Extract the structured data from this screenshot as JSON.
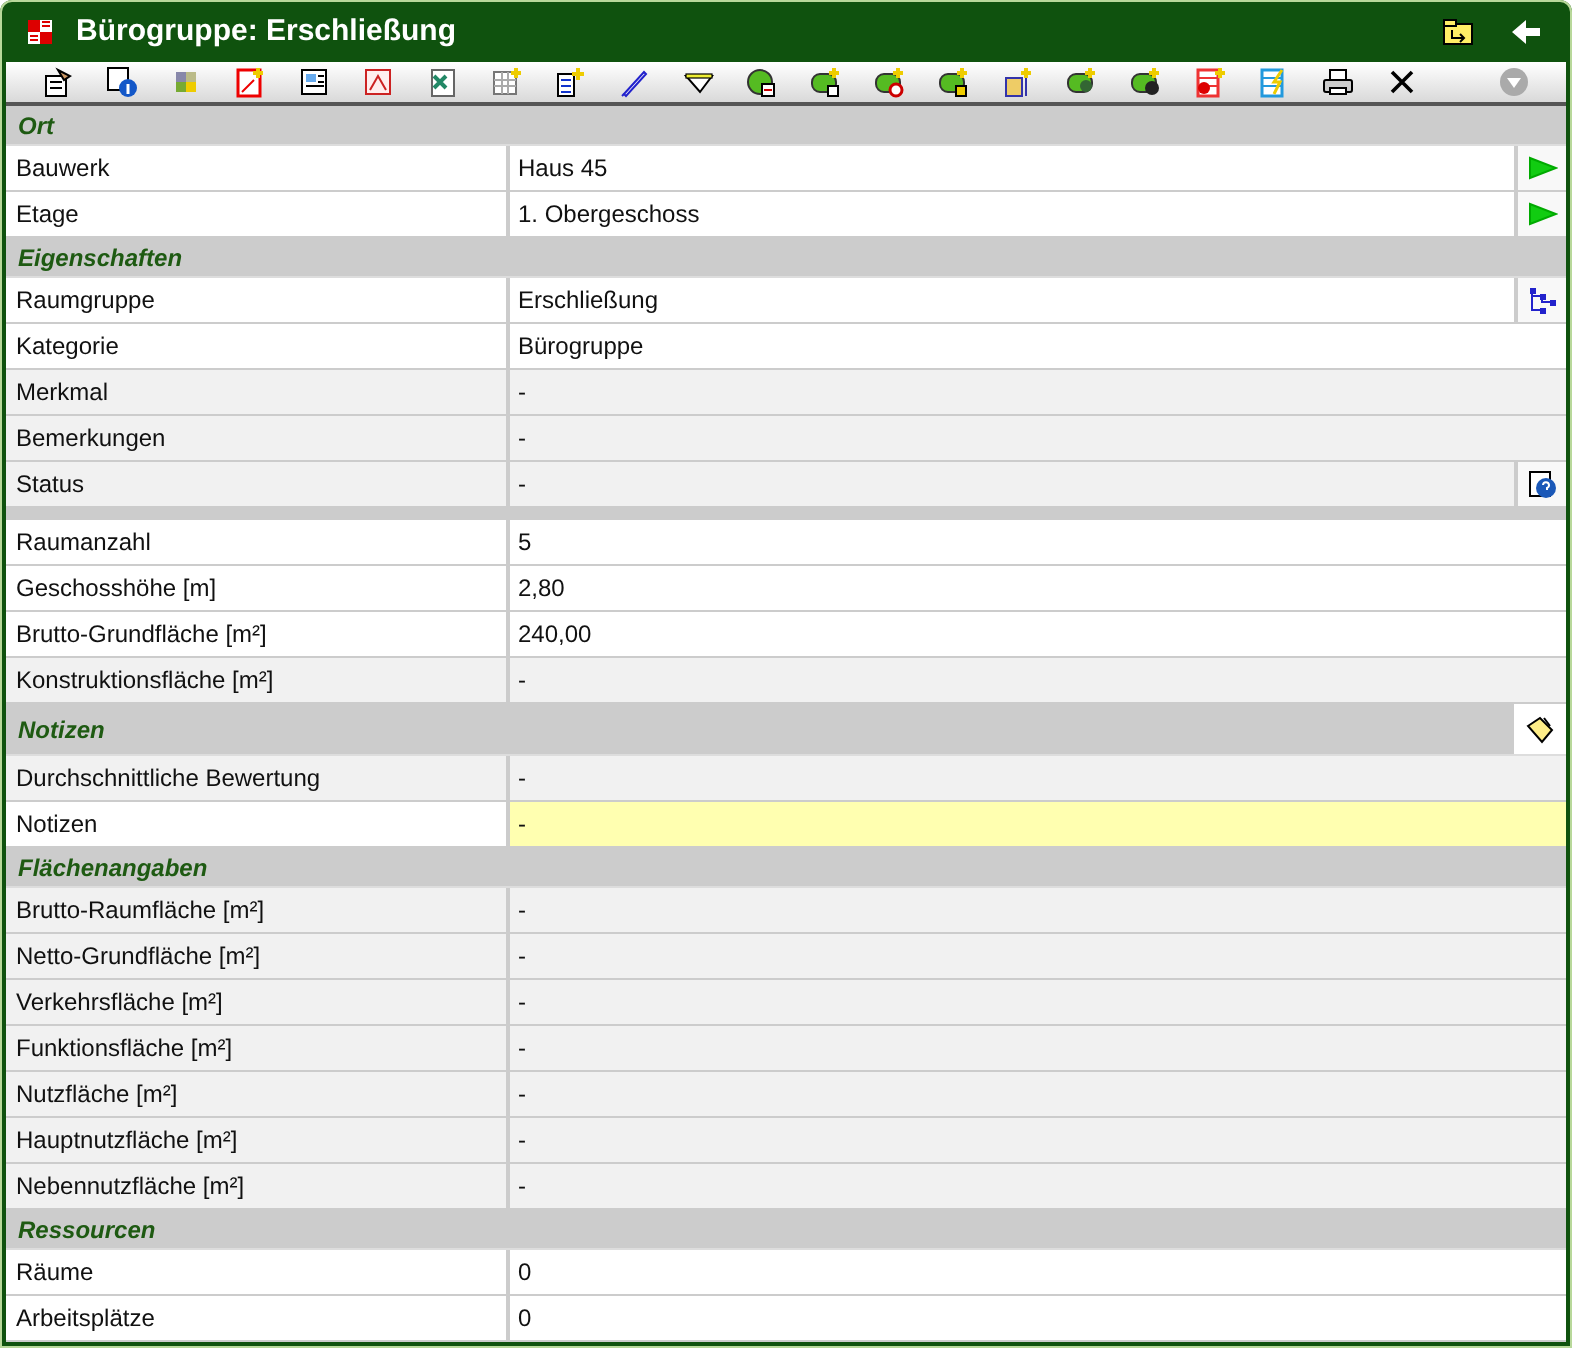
{
  "window": {
    "title": "Bürogruppe: Erschließung"
  },
  "sections": [
    {
      "kind": "titled",
      "title": "Ort",
      "rows": [
        {
          "kind": "link",
          "label": "Bauwerk",
          "value": "Haus 45",
          "dimmed": false,
          "highlighted": false
        },
        {
          "kind": "link",
          "label": "Etage",
          "value": "1. Obergeschoss",
          "dimmed": false,
          "highlighted": false
        }
      ]
    },
    {
      "kind": "titled",
      "title": "Eigenschaften",
      "rows": [
        {
          "kind": "tree",
          "label": "Raumgruppe",
          "value": "Erschließung",
          "dimmed": false,
          "highlighted": false
        },
        {
          "kind": "plain",
          "label": "Kategorie",
          "value": "Bürogruppe",
          "dimmed": false,
          "highlighted": false
        },
        {
          "kind": "plain",
          "label": "Merkmal",
          "value": "-",
          "dimmed": true,
          "highlighted": false
        },
        {
          "kind": "plain",
          "label": "Bemerkungen",
          "value": "-",
          "dimmed": true,
          "highlighted": false
        },
        {
          "kind": "help",
          "label": "Status",
          "value": "-",
          "dimmed": true,
          "highlighted": false
        }
      ]
    },
    {
      "kind": "spacer",
      "rows": [
        {
          "kind": "plain",
          "label": "Raumanzahl",
          "value": "5",
          "dimmed": false,
          "highlighted": false
        },
        {
          "kind": "plain",
          "label": "Geschosshöhe [m]",
          "value": "2,80",
          "dimmed": false,
          "highlighted": false
        },
        {
          "kind": "plain",
          "label": "Brutto-Grundfläche [m²]",
          "value": "240,00",
          "dimmed": false,
          "highlighted": false
        },
        {
          "kind": "plain",
          "label": "Konstruktionsfläche [m²]",
          "value": "-",
          "dimmed": true,
          "highlighted": false
        }
      ]
    },
    {
      "kind": "notes",
      "title": "Notizen",
      "rows": [
        {
          "kind": "plain",
          "label": "Durchschnittliche Bewertung",
          "value": "-",
          "dimmed": true,
          "highlighted": false
        },
        {
          "kind": "plain",
          "label": "Notizen",
          "value": "-",
          "dimmed": false,
          "highlighted": true
        }
      ]
    },
    {
      "kind": "titled",
      "title": "Flächenangaben",
      "rows": [
        {
          "kind": "plain",
          "label": "Brutto-Raumfläche [m²]",
          "value": "-",
          "dimmed": true,
          "highlighted": false
        },
        {
          "kind": "plain",
          "label": "Netto-Grundfläche [m²]",
          "value": "-",
          "dimmed": true,
          "highlighted": false
        },
        {
          "kind": "plain",
          "label": "Verkehrsfläche [m²]",
          "value": "-",
          "dimmed": true,
          "highlighted": false
        },
        {
          "kind": "plain",
          "label": "Funktionsfläche [m²]",
          "value": "-",
          "dimmed": true,
          "highlighted": false
        },
        {
          "kind": "plain",
          "label": "Nutzfläche [m²]",
          "value": "-",
          "dimmed": true,
          "highlighted": false
        },
        {
          "kind": "plain",
          "label": "Hauptnutzfläche [m²]",
          "value": "-",
          "dimmed": true,
          "highlighted": false
        },
        {
          "kind": "plain",
          "label": "Nebennutzfläche [m²]",
          "value": "-",
          "dimmed": true,
          "highlighted": false
        }
      ]
    },
    {
      "kind": "titled",
      "title": "Ressourcen",
      "rows": [
        {
          "kind": "plain",
          "label": "Räume",
          "value": "0",
          "dimmed": false,
          "highlighted": false
        },
        {
          "kind": "plain",
          "label": "Arbeitsplätze",
          "value": "0",
          "dimmed": false,
          "highlighted": false
        }
      ]
    }
  ]
}
